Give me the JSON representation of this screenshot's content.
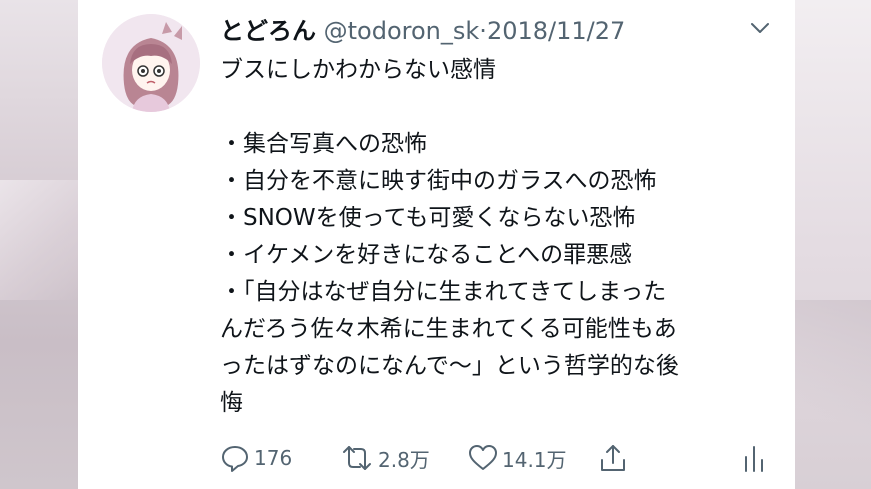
{
  "tweet": {
    "display_name": "とどろん",
    "handle": "@todoron_sk",
    "separator": "·",
    "date": "2018/11/27",
    "lines": [
      "ブスにしかわからない感情",
      "",
      "・集合写真への恐怖",
      "・自分を不意に映す街中のガラスへの恐怖",
      "・SNOWを使っても可愛くならない恐怖",
      "・イケメンを好きになることへの罪悪感",
      "・「自分はなぜ自分に生まれてきてしまった",
      "んだろう佐々木希に生まれてくる可能性もあ",
      "ったはずなのになんで〜」という哲学的な後",
      "悔"
    ]
  },
  "actions": {
    "reply_count": "176",
    "retweet_count": "2.8万",
    "like_count": "14.1万"
  },
  "icons": {
    "reply": "reply-icon",
    "retweet": "retweet-icon",
    "like": "heart-icon",
    "share": "share-icon",
    "analytics": "analytics-icon",
    "more": "chevron-down-icon"
  },
  "colors": {
    "text": "#0f1419",
    "secondary": "#536471",
    "avatar_bg": "#f1e6ef"
  }
}
